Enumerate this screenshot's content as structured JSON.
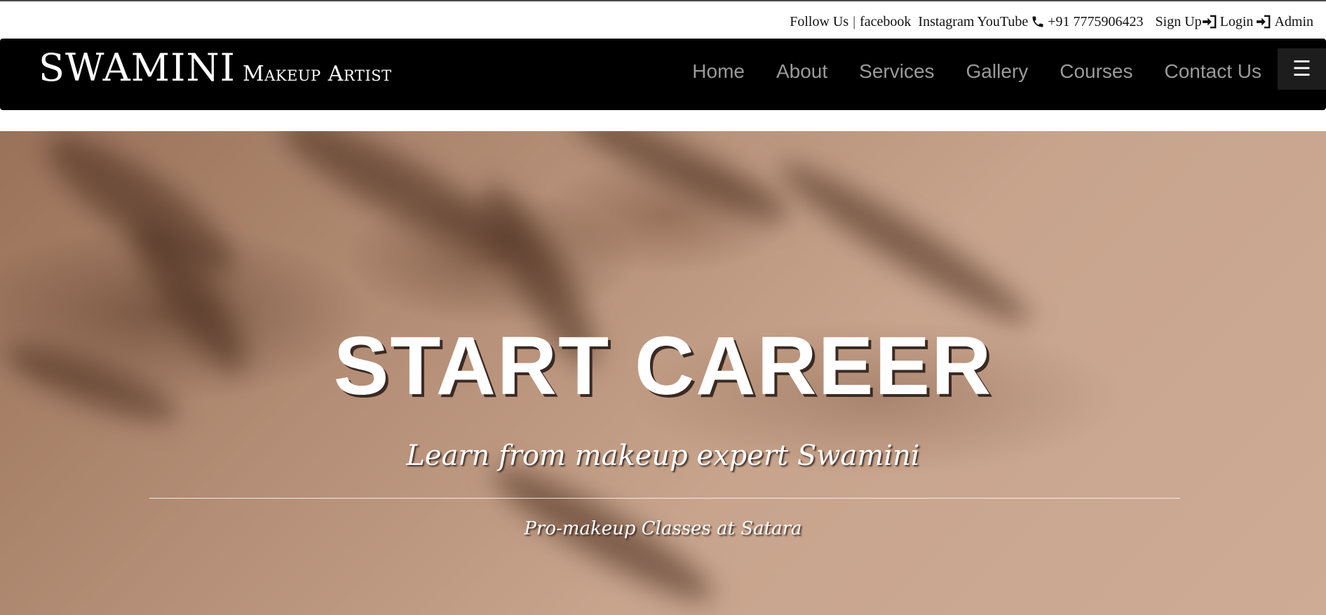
{
  "topbar": {
    "follow_label": "Follow Us",
    "separator": "|",
    "facebook": "facebook",
    "instagram": "Instagram",
    "youtube": "YouTube",
    "phone": "+91 7775906423",
    "signup": "Sign Up",
    "login": "Login",
    "admin": "Admin"
  },
  "brand": {
    "name": "SWAMINI",
    "tagline": "Makeup Artist"
  },
  "nav": {
    "items": [
      {
        "label": "Home"
      },
      {
        "label": "About"
      },
      {
        "label": "Services"
      },
      {
        "label": "Gallery"
      },
      {
        "label": "Courses"
      },
      {
        "label": "Contact Us"
      }
    ],
    "menu_icon": "☰"
  },
  "hero": {
    "title": "START CAREER",
    "subtitle": "Learn from makeup expert Swamini",
    "tagline": "Pro-makeup Classes at Satara"
  },
  "icons": {
    "phone": "phone-icon",
    "signin": "sign-in-icon",
    "menu": "hamburger-icon"
  },
  "colors": {
    "navbar_bg": "#000000",
    "nav_link": "#9a9a9a",
    "hero_tone": "#c8a48d"
  }
}
